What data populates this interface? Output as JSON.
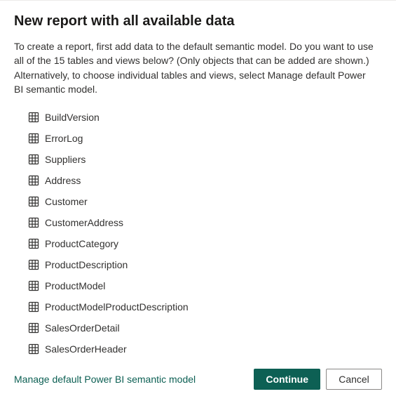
{
  "dialog": {
    "title": "New report with all available data",
    "description": "To create a report, first add data to the default semantic model. Do you want to use all of the 15 tables and views below? (Only objects that can be added are shown.) Alternatively, to choose individual tables and views, select Manage default Power BI semantic model.",
    "tables": [
      "BuildVersion",
      "ErrorLog",
      "Suppliers",
      "Address",
      "Customer",
      "CustomerAddress",
      "ProductCategory",
      "ProductDescription",
      "ProductModel",
      "ProductModelProductDescription",
      "SalesOrderDetail",
      "SalesOrderHeader"
    ],
    "footer": {
      "manage_link": "Manage default Power BI semantic model",
      "continue_label": "Continue",
      "cancel_label": "Cancel"
    }
  }
}
